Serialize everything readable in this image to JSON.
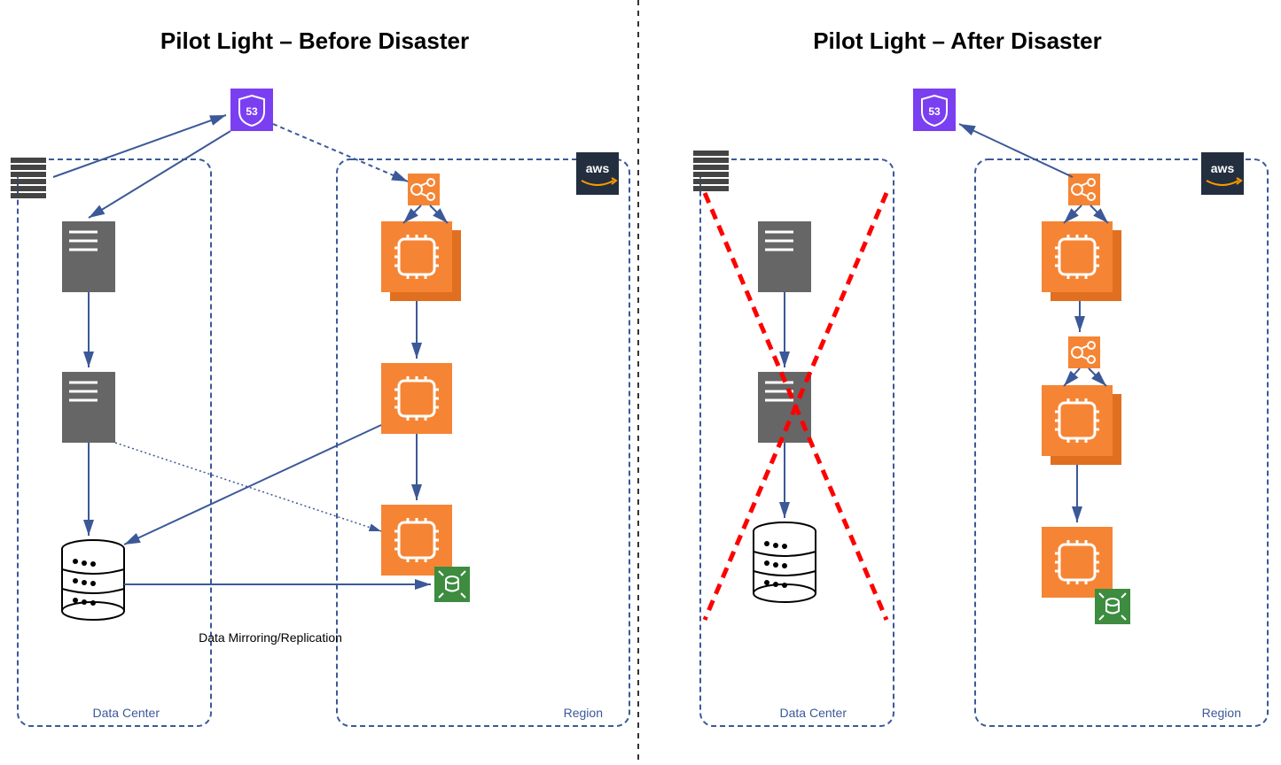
{
  "left": {
    "title": "Pilot Light – Before Disaster",
    "data_center": "Data Center",
    "region": "Region",
    "aws_logo": "aws",
    "route53": "53",
    "data_mirror": "Data Mirroring/Replication"
  },
  "right": {
    "title": "Pilot Light – After Disaster",
    "data_center": "Data Center",
    "region": "Region",
    "aws_logo": "aws",
    "route53": "53"
  }
}
